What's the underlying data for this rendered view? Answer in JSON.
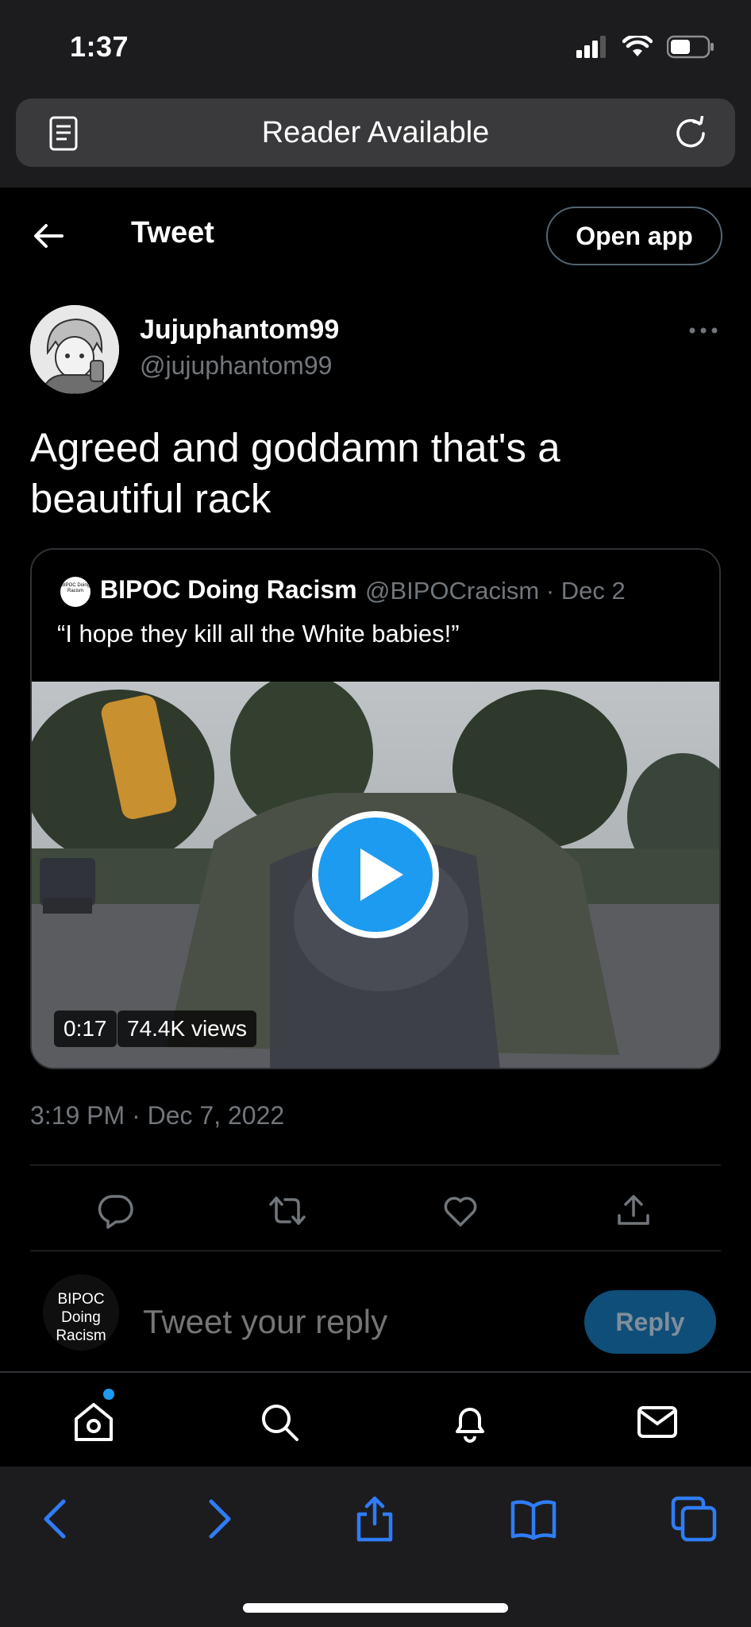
{
  "status_bar": {
    "time": "1:37"
  },
  "safari": {
    "url_text": "Reader Available"
  },
  "header": {
    "title": "Tweet",
    "open_app_label": "Open app"
  },
  "tweet": {
    "display_name": "Jujuphantom99",
    "handle": "@jujuphantom99",
    "text": "Agreed and goddamn that's a beautiful rack",
    "timestamp": "3:19 PM · Dec 7, 2022"
  },
  "quote": {
    "avatar_text": "BIPOC Doing Racism",
    "display_name": "BIPOC Doing Racism",
    "handle_date": "@BIPOCracism · Dec 2",
    "text": "“I hope they kill all the White babies!”",
    "video_duration": "0:17",
    "video_views": "74.4K views"
  },
  "reply": {
    "avatar_text": "BIPOC Doing Racism",
    "placeholder": "Tweet your reply",
    "button_label": "Reply"
  },
  "colors": {
    "accent": "#1d9bf0",
    "background": "#000000",
    "secondary_text": "#71767b",
    "safari_chrome": "#1c1c1e",
    "safari_blue": "#2f7cf6"
  },
  "icons": {
    "header": [
      "back-arrow-icon"
    ],
    "actions": [
      "reply-icon",
      "retweet-icon",
      "like-icon",
      "share-icon"
    ],
    "nav": [
      "home-icon",
      "search-icon",
      "notifications-icon",
      "messages-icon"
    ],
    "safari_toolbar": [
      "back-icon",
      "forward-icon",
      "share-icon",
      "bookmarks-icon",
      "tabs-icon"
    ]
  }
}
